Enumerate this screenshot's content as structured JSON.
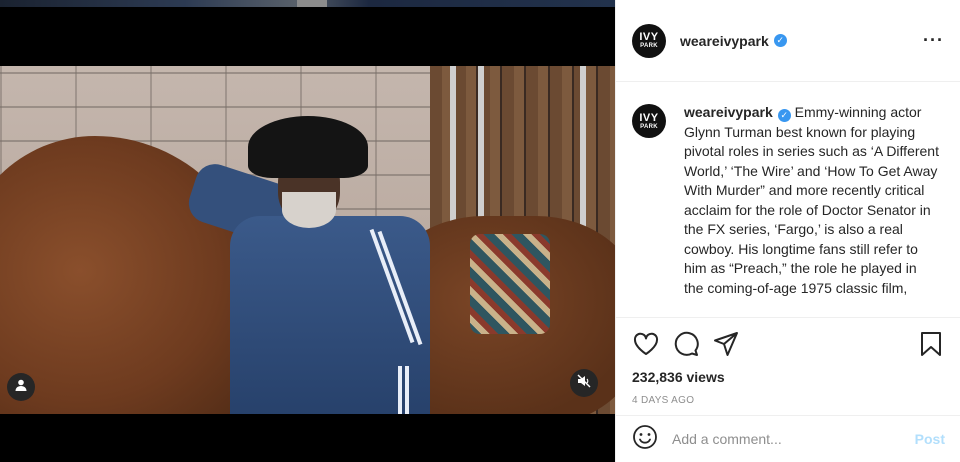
{
  "post": {
    "username": "weareivypark",
    "avatar_line1": "IVY",
    "avatar_line2": "PARK",
    "verified_icon": "verified-badge-icon",
    "more_icon": "more-options-icon",
    "caption": "Emmy-winning actor Glynn Turman best known for playing pivotal roles in series such as ‘A Different World,’ ‘The Wire’ and ‘How To Get Away With Murder” and more recently critical acclaim for the role of Doctor Senator in the FX series, ‘Fargo,’ is also a real cowboy. His longtime fans still refer to him as “Preach,” the role he played in the coming-of-age 1975 classic film,",
    "views": "232,836 views",
    "date": "4 DAYS AGO"
  },
  "actions": {
    "like_icon": "heart-icon",
    "comment_icon": "comment-icon",
    "share_icon": "share-icon",
    "save_icon": "bookmark-icon"
  },
  "comment": {
    "placeholder": "Add a comment...",
    "post_label": "Post",
    "emoji_icon": "emoji-icon"
  },
  "media": {
    "tag_icon": "user-tag-icon",
    "mute_icon": "muted-audio-icon"
  },
  "colors": {
    "accent": "#3897f0",
    "post_disabled": "#b2dffc",
    "text": "#262626",
    "muted": "#8e8e8e"
  }
}
